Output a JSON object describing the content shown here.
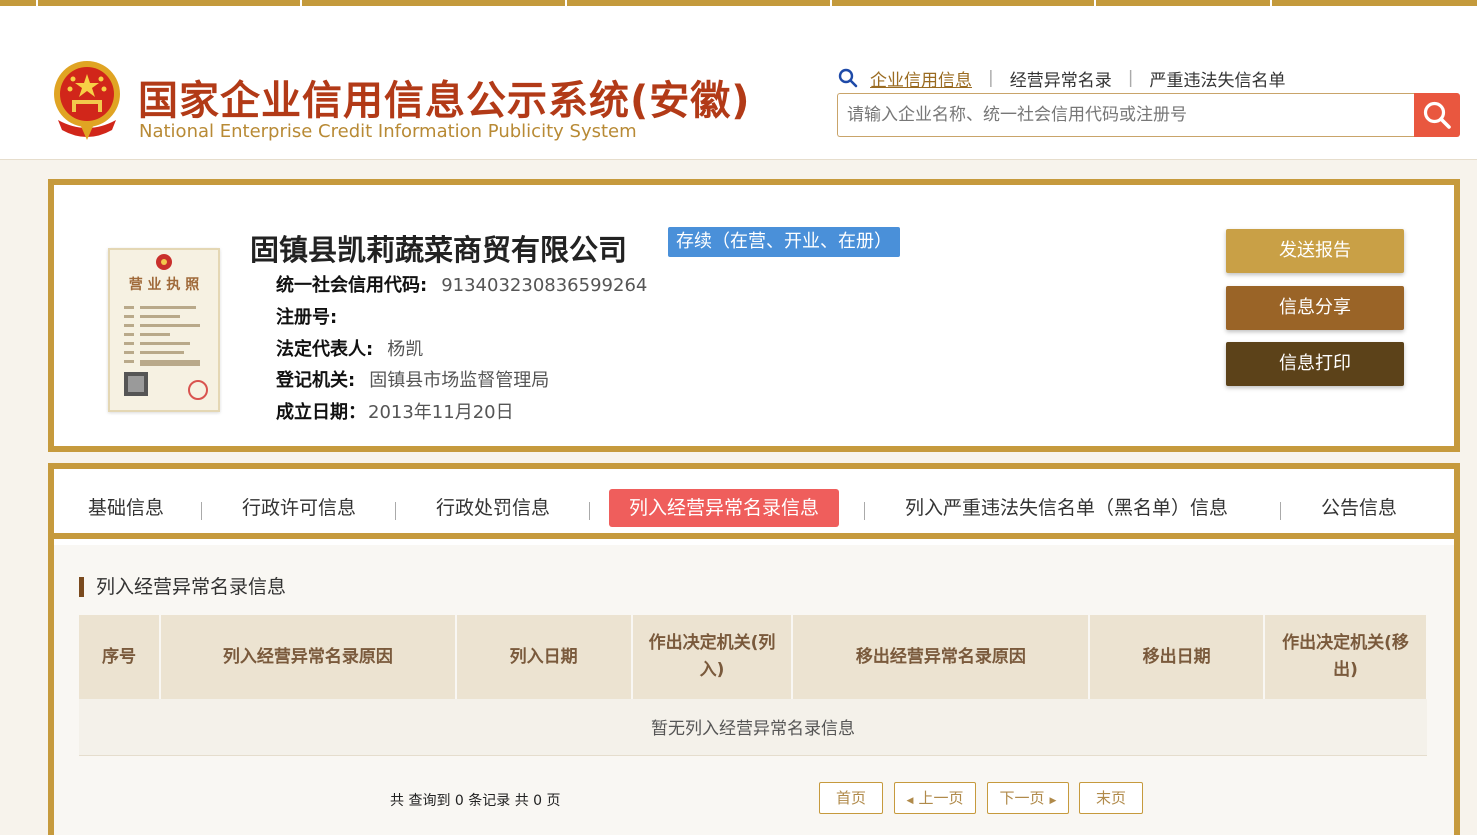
{
  "header": {
    "title_cn": "国家企业信用信息公示系统(安徽)",
    "title_en": "National Enterprise Credit Information Publicity System",
    "nav": [
      {
        "label": "企业信用信息"
      },
      {
        "label": "经营异常名录"
      },
      {
        "label": "严重违法失信名单"
      }
    ],
    "nav_separator": "|",
    "search_placeholder": "请输入企业名称、统一社会信用代码或注册号"
  },
  "company": {
    "name": "固镇县凯莉蔬菜商贸有限公司",
    "status": "存续（在营、开业、在册）",
    "fields": [
      {
        "label": "统一社会信用代码:",
        "value": "913403230836599264"
      },
      {
        "label": "注册号:",
        "value": ""
      },
      {
        "label": "法定代表人:",
        "value": "杨凯"
      },
      {
        "label": "登记机关:",
        "value": "固镇县市场监督管理局"
      },
      {
        "label": "成立日期：",
        "value": "2013年11月20日"
      }
    ],
    "license_title": "营 业 执 照"
  },
  "actions": {
    "send_report": "发送报告",
    "share": "信息分享",
    "print": "信息打印"
  },
  "tabs": [
    {
      "label": "基础信息"
    },
    {
      "label": "行政许可信息"
    },
    {
      "label": "行政处罚信息"
    },
    {
      "label": "列入经营异常名录信息"
    },
    {
      "label": "列入严重违法失信名单（黑名单）信息"
    },
    {
      "label": "公告信息"
    }
  ],
  "section": {
    "title": "列入经营异常名录信息",
    "columns": [
      "序号",
      "列入经营异常名录原因",
      "列入日期",
      "作出决定机关(列入)",
      "移出经营异常名录原因",
      "移出日期",
      "作出决定机关(移出)"
    ],
    "empty_text": "暂无列入经营异常名录信息"
  },
  "pager": {
    "summary": "共 查询到 0 条记录 共 0 页",
    "first": "首页",
    "prev": "上一页",
    "next": "下一页",
    "last": "末页"
  },
  "colors": {
    "gold": "#c69a3d",
    "brand_red": "#b23a17",
    "status_blue": "#4a90d9",
    "active_tab": "#ef5e5c",
    "btn_report": "#c9a046",
    "btn_share": "#9a6427",
    "btn_print": "#5c4219"
  }
}
